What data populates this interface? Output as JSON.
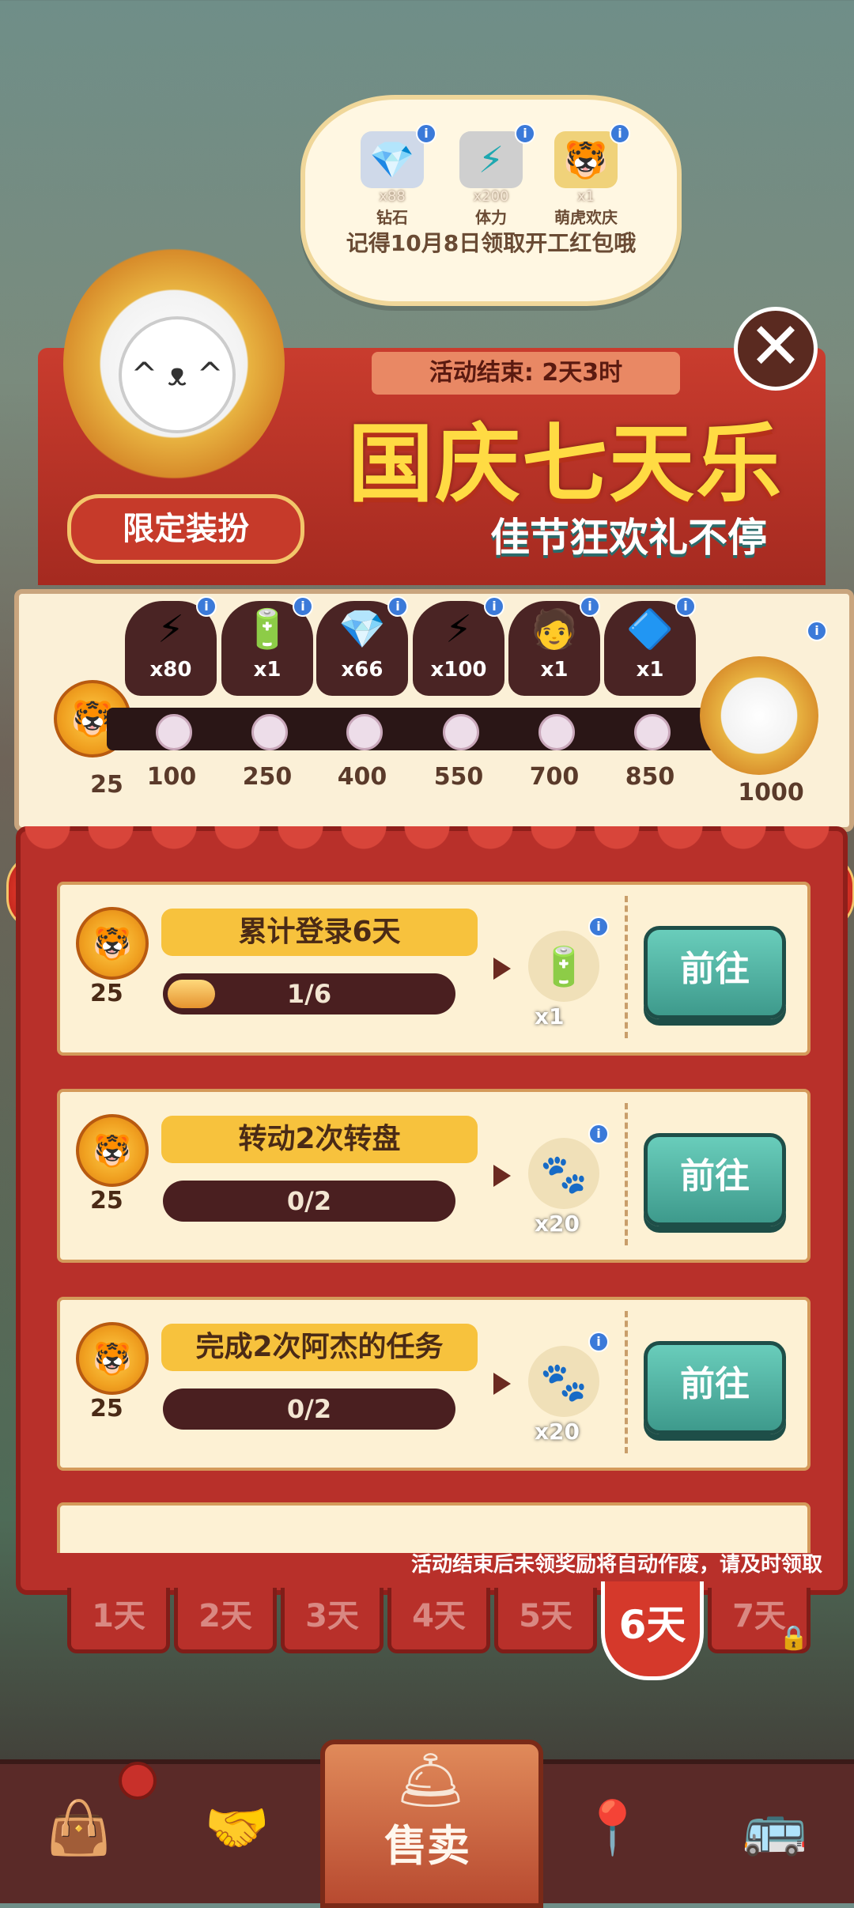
{
  "bubble": {
    "items": [
      {
        "icon": "diamond-icon",
        "glyph": "💎",
        "qty": "x88",
        "name": "钻石"
      },
      {
        "icon": "energy-icon",
        "glyph": "⚡",
        "qty": "x200",
        "name": "体力"
      },
      {
        "icon": "tiger-costume-icon",
        "glyph": "🐯",
        "qty": "x1",
        "name": "萌虎欢庆"
      }
    ],
    "note": "记得10月8日领取开工红包哦"
  },
  "close_glyph": "✕",
  "banner": {
    "end_time": "活动结束: 2天3时",
    "title": "国庆七天乐",
    "subtitle": "佳节狂欢礼不停",
    "costume_label": "限定装扮"
  },
  "track": {
    "current_points": "25",
    "slots": [
      {
        "icon": "energy-icon",
        "glyph": "⚡",
        "qty": "x80",
        "threshold": "100"
      },
      {
        "icon": "battery-icon",
        "glyph": "🔋",
        "qty": "x1",
        "threshold": "250"
      },
      {
        "icon": "diamond-icon",
        "glyph": "💎",
        "qty": "x66",
        "threshold": "400"
      },
      {
        "icon": "energy-icon",
        "glyph": "⚡",
        "qty": "x100",
        "threshold": "550"
      },
      {
        "icon": "chef-avatar-icon",
        "glyph": "🧑",
        "qty": "x1",
        "threshold": "700"
      },
      {
        "icon": "crystal-icon",
        "glyph": "🔷",
        "qty": "x1",
        "threshold": "850"
      }
    ],
    "final_threshold": "1000"
  },
  "tasks": [
    {
      "title": "累计登录6天",
      "progress": "1/6",
      "progress_fraction": 0.1667,
      "points": "25",
      "reward_icon": "battery-icon",
      "reward_glyph": "🔋",
      "reward_qty": "x1",
      "button": "前往"
    },
    {
      "title": "转动2次转盘",
      "progress": "0/2",
      "progress_fraction": 0,
      "points": "25",
      "reward_icon": "paw-coin-icon",
      "reward_glyph": "🐾",
      "reward_qty": "x20",
      "button": "前往"
    },
    {
      "title": "完成2次阿杰的任务",
      "progress": "0/2",
      "progress_fraction": 0,
      "points": "25",
      "reward_icon": "paw-coin-icon",
      "reward_glyph": "🐾",
      "reward_qty": "x20",
      "button": "前往"
    }
  ],
  "footnote": "活动结束后未领奖励将自动作废，请及时领取",
  "day_tabs": [
    "1天",
    "2天",
    "3天",
    "4天",
    "5天",
    "6天",
    "7天"
  ],
  "active_day_index": 5,
  "nav": {
    "sell_label": "售卖",
    "items": [
      {
        "icon": "bag-icon",
        "glyph": "👜"
      },
      {
        "icon": "handshake-icon",
        "glyph": "🤝"
      },
      {
        "icon": "map-pin-icon",
        "glyph": "📍"
      },
      {
        "icon": "bus-icon",
        "glyph": "🚌"
      }
    ]
  }
}
